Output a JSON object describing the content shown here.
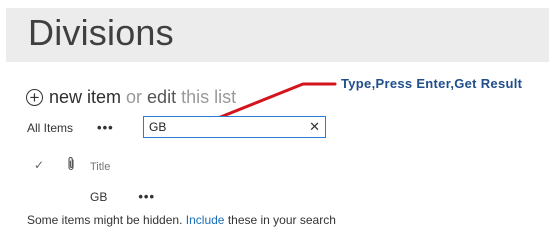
{
  "page": {
    "title": "Divisions"
  },
  "commands": {
    "new_item": "new item",
    "or": "or",
    "edit": "edit",
    "this_list": "this list"
  },
  "annotation": {
    "text": "Type,Press Enter,Get Result",
    "color": "#1f4e8c",
    "arrow_color": "#d4141c"
  },
  "view": {
    "name": "All Items",
    "more": "•••"
  },
  "search": {
    "value": "GB",
    "clear_glyph": "✕"
  },
  "list": {
    "columns": {
      "title": "Title"
    },
    "rows": [
      {
        "title": "GB",
        "more": "•••"
      }
    ]
  },
  "notice": {
    "prefix": "Some items might be hidden.",
    "link": "Include",
    "suffix": "these in your search"
  },
  "colors": {
    "header_band": "#ececec",
    "link": "#1a6fb5",
    "search_border": "#2b7bd1"
  }
}
